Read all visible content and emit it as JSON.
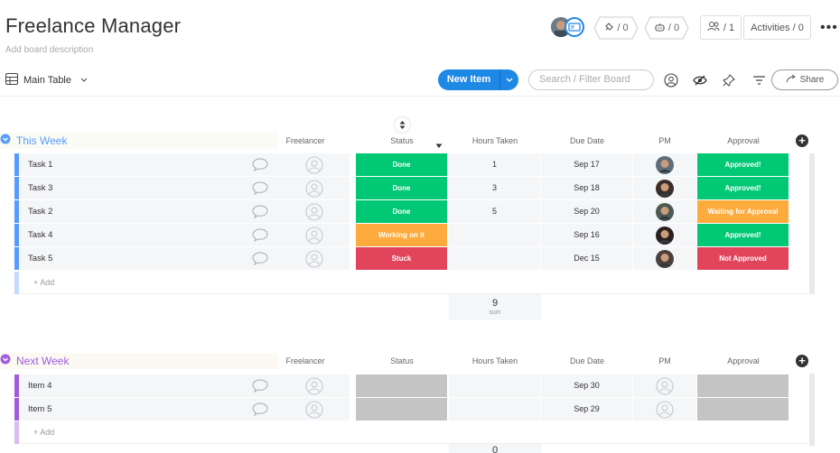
{
  "header": {
    "title": "Freelance Manager",
    "description": "Add board description",
    "integrations_count": "/ 0",
    "automations_count": "/ 0",
    "members_count": "/ 1",
    "activities_label": "Activities / 0",
    "more": "•••"
  },
  "toolbar": {
    "view_label": "Main Table",
    "new_item_label": "New Item",
    "search_placeholder": "Search / Filter Board",
    "share_label": "Share"
  },
  "columns": [
    "Freelancer",
    "Status",
    "Hours Taken",
    "Due Date",
    "PM",
    "Approval"
  ],
  "groups": [
    {
      "title": "This Week",
      "color": "#579bfc",
      "rows": [
        {
          "name": "Task 1",
          "status": "Done",
          "status_color": "#00c875",
          "hours": "1",
          "due": "Sep 17",
          "approval": "Approved!",
          "approval_color": "#00c875"
        },
        {
          "name": "Task 3",
          "status": "Done",
          "status_color": "#00c875",
          "hours": "3",
          "due": "Sep 18",
          "approval": "Approved!",
          "approval_color": "#00c875"
        },
        {
          "name": "Task 2",
          "status": "Done",
          "status_color": "#00c875",
          "hours": "5",
          "due": "Sep 20",
          "approval": "Waiting for Approval",
          "approval_color": "#fdab3d"
        },
        {
          "name": "Task 4",
          "status": "Working on it",
          "status_color": "#fdab3d",
          "hours": "",
          "due": "Sep 16",
          "approval": "Approved!",
          "approval_color": "#00c875"
        },
        {
          "name": "Task 5",
          "status": "Stuck",
          "status_color": "#e2445c",
          "hours": "",
          "due": "Dec 15",
          "approval": "Not Approved",
          "approval_color": "#e2445c"
        }
      ],
      "add_label": "+ Add",
      "sum_value": "9",
      "sum_label": "sum"
    },
    {
      "title": "Next Week",
      "color": "#a25ddc",
      "rows": [
        {
          "name": "Item 4",
          "status": "",
          "status_color": "#c4c4c4",
          "hours": "",
          "due": "Sep 30",
          "approval": "",
          "approval_color": "#c4c4c4"
        },
        {
          "name": "Item 5",
          "status": "",
          "status_color": "#c4c4c4",
          "hours": "",
          "due": "Sep 29",
          "approval": "",
          "approval_color": "#c4c4c4"
        }
      ],
      "add_label": "+ Add",
      "sum_value": "0"
    }
  ]
}
